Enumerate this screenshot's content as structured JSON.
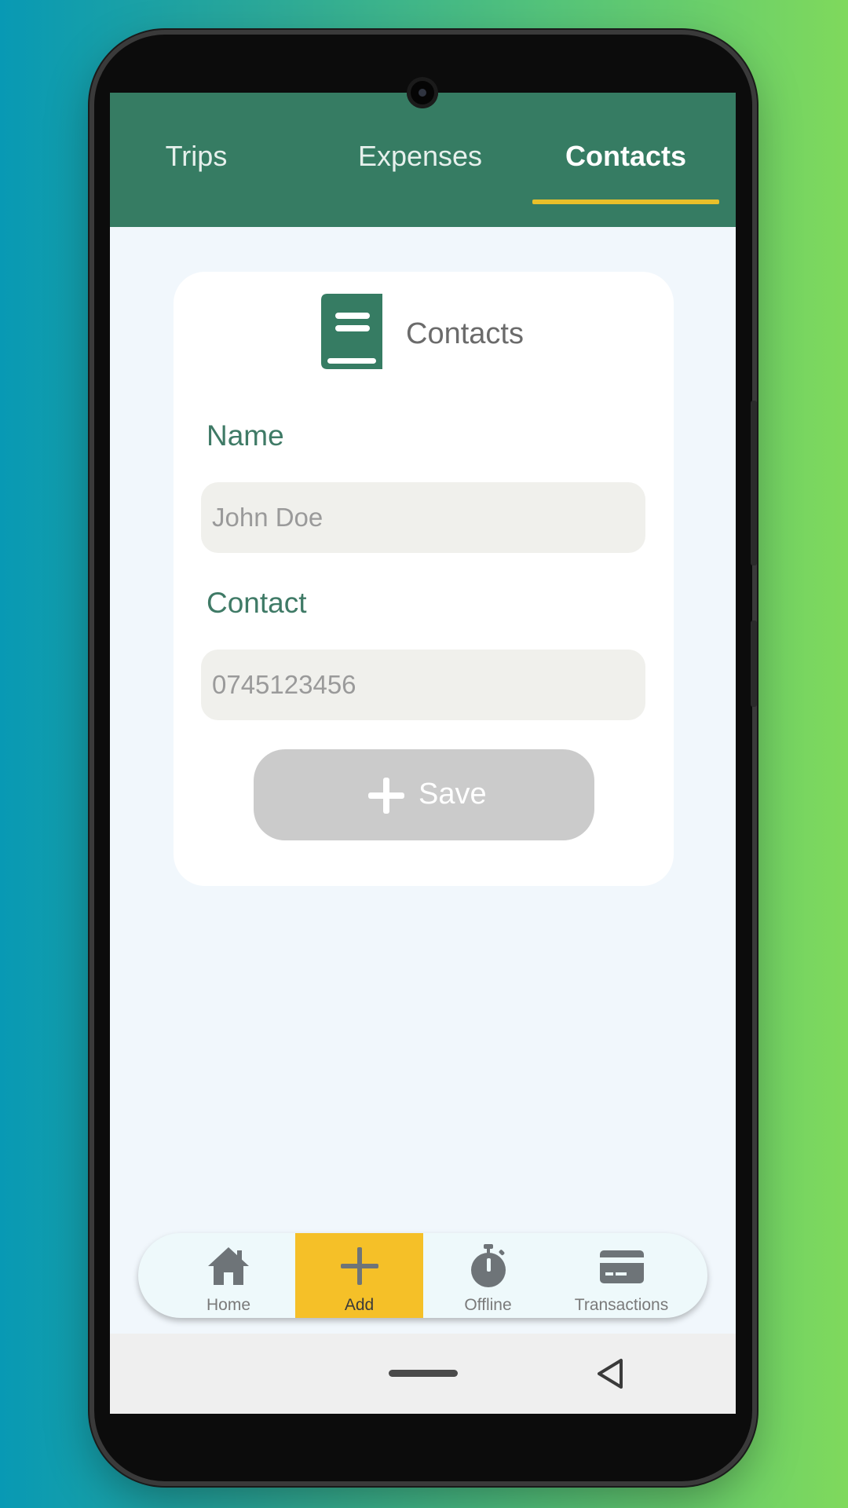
{
  "tabs": [
    {
      "label": "Trips",
      "active": false
    },
    {
      "label": "Expenses",
      "active": false
    },
    {
      "label": "Contacts",
      "active": true
    }
  ],
  "card": {
    "title": "Contacts",
    "icon": "contact-book-icon",
    "fields": [
      {
        "label": "Name",
        "placeholder": "John Doe",
        "value": ""
      },
      {
        "label": "Contact",
        "placeholder": "0745123456",
        "value": ""
      }
    ],
    "save_label": "Save"
  },
  "bottom_nav": [
    {
      "label": "Home",
      "icon": "home-icon",
      "active": false
    },
    {
      "label": "Add",
      "icon": "plus-icon",
      "active": true
    },
    {
      "label": "Offline",
      "icon": "stopwatch-icon",
      "active": false
    },
    {
      "label": "Transactions",
      "icon": "credit-card-icon",
      "active": false
    }
  ],
  "colors": {
    "primary": "#367c63",
    "accent": "#f5c028",
    "tab_indicator": "#e9c02a",
    "field_label": "#3f7a66",
    "button_disabled": "#cbcbcb"
  }
}
